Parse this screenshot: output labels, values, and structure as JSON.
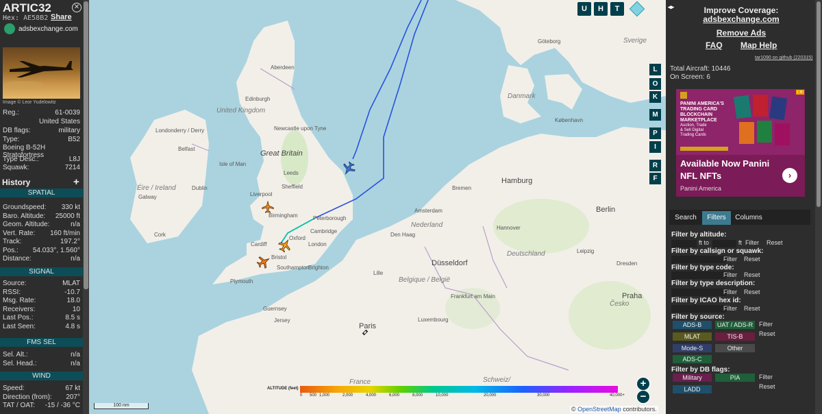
{
  "aircraft": {
    "callsign": "ARTIC32",
    "hex_label": "Hex:",
    "hex": "AE58B2",
    "share": "Share",
    "source_site": "adsbexchange.com",
    "photo_credit": "Image © Leor Yudelowitz"
  },
  "details": [
    {
      "k": "Reg.:",
      "v": "61-0039"
    },
    {
      "k": "",
      "v": "United States"
    },
    {
      "k": "DB flags:",
      "v": "military"
    },
    {
      "k": "Type:",
      "v": "B52"
    },
    {
      "k": "Boeing B-52H Stratofortress",
      "v": ""
    },
    {
      "k": "Type Desc.:",
      "v": "L8J"
    },
    {
      "k": "Squawk:",
      "v": "7214"
    }
  ],
  "history_label": "History",
  "sections": {
    "spatial": "SPATIAL",
    "signal": "SIGNAL",
    "fms": "FMS SEL",
    "wind": "WIND"
  },
  "spatial": [
    {
      "k": "Groundspeed:",
      "v": "330 kt"
    },
    {
      "k": "Baro. Altitude:",
      "v": "25000 ft"
    },
    {
      "k": "Geom. Altitude:",
      "v": "n/a"
    },
    {
      "k": "Vert. Rate:",
      "v": "160 ft/min"
    },
    {
      "k": "Track:",
      "v": "197.2°"
    },
    {
      "k": "Pos.:",
      "v": "54.033°, 1.560°"
    },
    {
      "k": "Distance:",
      "v": "n/a"
    }
  ],
  "signal": [
    {
      "k": "Source:",
      "v": "MLAT"
    },
    {
      "k": "RSSI:",
      "v": "-10.7"
    },
    {
      "k": "Msg. Rate:",
      "v": "18.0"
    },
    {
      "k": "Receivers:",
      "v": "10"
    },
    {
      "k": "Last Pos.:",
      "v": "8.5 s"
    },
    {
      "k": "Last Seen:",
      "v": "4.8 s"
    }
  ],
  "fms": [
    {
      "k": "Sel. Alt.:",
      "v": "n/a"
    },
    {
      "k": "Sel. Head.:",
      "v": "n/a"
    }
  ],
  "wind": [
    {
      "k": "Speed:",
      "v": "67 kt"
    },
    {
      "k": "Direction (from):",
      "v": "207°"
    },
    {
      "k": "TAT / OAT:",
      "v": "-15 / -36 °C"
    }
  ],
  "map": {
    "top_buttons": [
      "U",
      "H",
      "T"
    ],
    "side_buttons": [
      "L",
      "O",
      "K",
      "M",
      "P",
      "I",
      "R",
      "F"
    ],
    "zoom_in": "+",
    "zoom_out": "−",
    "attribution_prefix": "©",
    "attribution_link": "OpenStreetMap",
    "attribution_suffix": "contributors.",
    "scale": "100 nm",
    "altitude_label": "ALTITUDE (feet)",
    "altitude_ticks": [
      "0",
      "500",
      "1,000",
      "2,000",
      "4,000",
      "6,000",
      "8,000",
      "10,000",
      "20,000",
      "30,000",
      "40,000+"
    ],
    "labels": {
      "uk": "United Kingdom",
      "great_britain": "Great Britain",
      "ireland": "Éire / Ireland",
      "isle_of_man": "Isle of Man",
      "londonderry": "Londonderry / Derry",
      "belfast": "Belfast",
      "newcastle": "Newcastle upon Tyne",
      "aberdeen": "Aberdeen",
      "edinburgh": "Edinburgh",
      "liverpool": "Liverpool",
      "leeds": "Leeds",
      "sheffield": "Sheffield",
      "birmingham": "Birmingham",
      "cardiff": "Cardiff",
      "oxford": "Oxford",
      "london": "London",
      "bristol": "Bristol",
      "southampton": "Southampton",
      "plymouth": "Plymouth",
      "brighton": "Brighton",
      "dublin": "Dublin",
      "galway": "Galway",
      "cork": "Cork",
      "peterborough": "Peterborough",
      "cambridge": "Cambridge",
      "nederland": "Nederland",
      "amsterdam": "Amsterdam",
      "den_haag": "Den Haag",
      "belgique": "Belgique / België",
      "deutschland": "Deutschland",
      "hamburg": "Hamburg",
      "bremen": "Bremen",
      "hannover": "Hannover",
      "berlin": "Berlin",
      "dusseldorf": "Düsseldorf",
      "frankfurt": "Frankfurt am Main",
      "france": "France",
      "paris": "Paris",
      "luxembourg": "Luxembourg",
      "danmark": "Danmark",
      "kobenhavn": "København",
      "goteborg": "Göteborg",
      "sverige": "Sverige",
      "praha": "Praha",
      "cesko": "Česko",
      "schweiz": "Schweiz/",
      "dresden": "Dresden",
      "leipzig": "Leipzig",
      "lille": "Lille",
      "jersey": "Jersey",
      "guernsey": "Guernsey"
    }
  },
  "right": {
    "improve": "Improve Coverage:",
    "improve_link": "adsbexchange.com",
    "remove_ads": "Remove Ads",
    "faq": "FAQ",
    "map_help": "Map Help",
    "version": "tar1090 on github (220315)",
    "total_aircraft_label": "Total Aircraft:",
    "total_aircraft": "10446",
    "on_screen_label": "On Screen:",
    "on_screen": "6",
    "ad": {
      "tagline_1": "PANINI AMERICA'S",
      "tagline_2": "TRADING CARD",
      "tagline_3": "BLOCKCHAIN",
      "tagline_4": "MARKETPLACE",
      "tagline_5": "Auction, Trade",
      "tagline_6": "& Sell Digital",
      "tagline_7": "Trading Cards",
      "headline_1": "Available Now Panini",
      "headline_2": "NFL NFTs",
      "advertiser": "Panini America",
      "arrow": "›"
    },
    "tabs": [
      "Search",
      "Filters",
      "Columns"
    ],
    "filters": {
      "altitude": "Filter by altitude:",
      "ft_to": "ft to",
      "ft": "ft",
      "callsign": "Filter by callsign or squawk:",
      "type_code": "Filter by type code:",
      "type_desc": "Filter by type description:",
      "icao": "Filter by ICAO hex id:",
      "source": "Filter by source:",
      "db_flags": "Filter by DB flags:",
      "filter": "Filter",
      "reset": "Reset"
    },
    "sources": [
      "ADS-B",
      "UAT / ADS-R",
      "MLAT",
      "TIS-B",
      "Mode-S",
      "Other",
      "ADS-C"
    ],
    "db": [
      "Military",
      "PIA",
      "LADD"
    ],
    "colors": {
      "adsb": "#1f4f6a",
      "uat": "#1f5f3a",
      "mlat": "#5a5a1f",
      "tisb": "#6a1f3f",
      "modes": "#2f3f6a",
      "other": "#4a4a4a",
      "adsc": "#1f5f3a"
    }
  }
}
